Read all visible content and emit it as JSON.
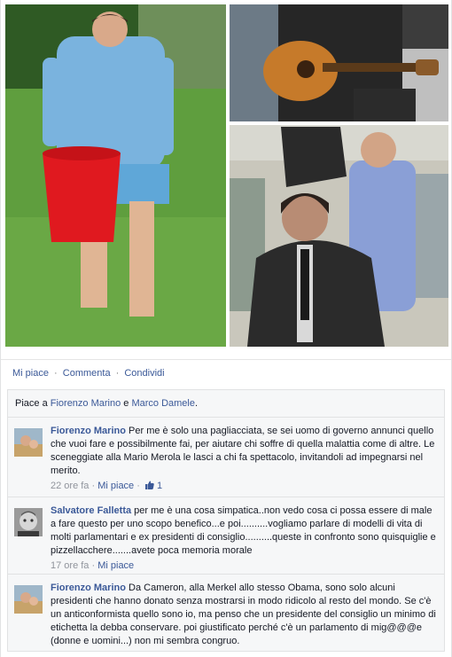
{
  "actions": {
    "like_label": "Mi piace",
    "comment_label": "Commenta",
    "share_label": "Condividi",
    "separator": "·"
  },
  "likes_summary": {
    "prefix": "Piace a ",
    "person1": "Fiorenzo Marino",
    "conjunction": " e ",
    "person2": "Marco Damele",
    "suffix": "."
  },
  "comments": [
    {
      "author": "Fiorenzo Marino",
      "text": "Per me è solo una pagliacciata, se sei uomo di governo annunci quello che vuoi fare e possibilmente fai, per aiutare chi soffre di quella malattia come di altre. Le sceneggiate alla Mario Merola le lasci a chi fa spettacolo, invitandoli ad impegnarsi nel merito.",
      "time": "22 ore fa",
      "like_label": "Mi piace",
      "like_count": "1"
    },
    {
      "author": "Salvatore Falletta",
      "text": "per me è una cosa simpatica..non vedo cosa ci possa essere di male a fare questo per uno scopo benefico...e poi..........vogliamo parlare di modelli di vita di molti parlamentari e ex presidenti di consiglio..........queste in confronto sono quisquiglie e pizzellacchere.......avete poca memoria morale",
      "time": "17 ore fa",
      "like_label": "Mi piace"
    },
    {
      "author": "Fiorenzo Marino",
      "text": "Da Cameron, alla Merkel allo stesso Obama, sono solo alcuni presidenti che hanno donato senza mostrarsi in modo ridicolo al resto del mondo. Se c'è un anticonformista quello sono io, ma penso che un presidente del consiglio un minimo di etichetta la debba conservare. poi giustificato perché c'è un parlamento di mig@@@e (donne e uomini...) non mi sembra congruo."
    }
  ],
  "colors": {
    "link": "#3b5998",
    "meta": "#90949c",
    "ufi_bg": "#f6f7f8",
    "border": "#e1e2e3"
  }
}
